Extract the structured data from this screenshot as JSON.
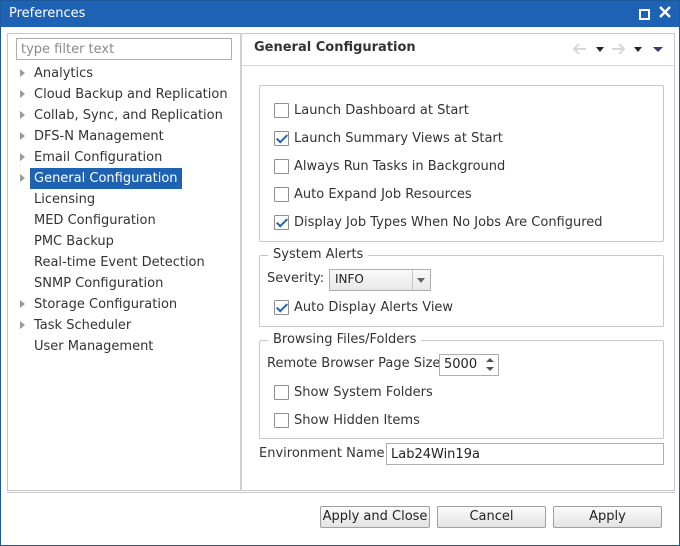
{
  "window": {
    "title": "Preferences"
  },
  "filter": {
    "placeholder": "type filter text",
    "value": ""
  },
  "tree": {
    "items": [
      {
        "label": "Analytics",
        "expandable": true
      },
      {
        "label": "Cloud Backup and Replication",
        "expandable": true
      },
      {
        "label": "Collab, Sync, and Replication",
        "expandable": true
      },
      {
        "label": "DFS-N Management",
        "expandable": true
      },
      {
        "label": "Email Configuration",
        "expandable": true
      },
      {
        "label": "General Configuration",
        "expandable": true,
        "selected": true
      },
      {
        "label": "Licensing",
        "expandable": false
      },
      {
        "label": "MED Configuration",
        "expandable": false
      },
      {
        "label": "PMC Backup",
        "expandable": false
      },
      {
        "label": "Real-time Event Detection",
        "expandable": false
      },
      {
        "label": "SNMP Configuration",
        "expandable": false
      },
      {
        "label": "Storage Configuration",
        "expandable": true
      },
      {
        "label": "Task Scheduler",
        "expandable": true
      },
      {
        "label": "User Management",
        "expandable": false
      }
    ]
  },
  "page": {
    "title": "General Configuration",
    "general_options": [
      {
        "label": "Launch Dashboard at Start",
        "checked": false
      },
      {
        "label": "Launch Summary Views at Start",
        "checked": true
      },
      {
        "label": "Always Run Tasks in Background",
        "checked": false
      },
      {
        "label": "Auto Expand Job Resources",
        "checked": false
      },
      {
        "label": "Display Job Types When No Jobs Are Configured",
        "checked": true
      }
    ],
    "system_alerts": {
      "title": "System Alerts",
      "severity_label": "Severity:",
      "severity_value": "INFO",
      "auto_display": {
        "label": "Auto Display Alerts View",
        "checked": true
      }
    },
    "browsing": {
      "title": "Browsing Files/Folders",
      "page_size_label": "Remote Browser Page Size:",
      "page_size_value": "5000",
      "show_system": {
        "label": "Show System Folders",
        "checked": false
      },
      "show_hidden": {
        "label": "Show Hidden Items",
        "checked": false
      }
    },
    "environment": {
      "label": "Environment Name:",
      "value": "Lab24Win19a"
    }
  },
  "buttons": {
    "apply_close": "Apply and Close",
    "cancel": "Cancel",
    "apply": "Apply"
  },
  "colors": {
    "accent": "#1e63b3",
    "titlebar": "#1e63b3"
  }
}
